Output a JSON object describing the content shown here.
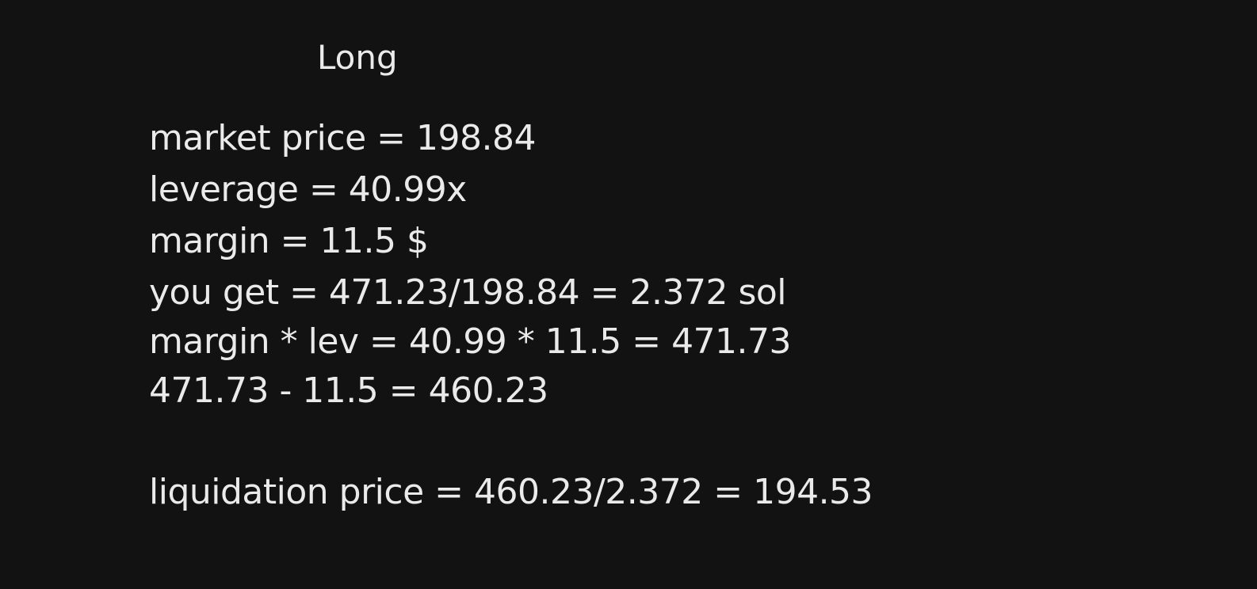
{
  "title": "Long",
  "lines": [
    "market price = 198.84",
    "leverage = 40.99x",
    "margin = 11.5 $",
    "you get = 471.23/198.84 = 2.372 sol",
    "margin * lev = 40.99 * 11.5 = 471.73",
    "471.73 - 11.5 = 460.23"
  ],
  "result_line": "liquidation price = 460.23/2.372 = 194.53",
  "colors": {
    "background": "#121212",
    "text": "#eaeaea"
  }
}
